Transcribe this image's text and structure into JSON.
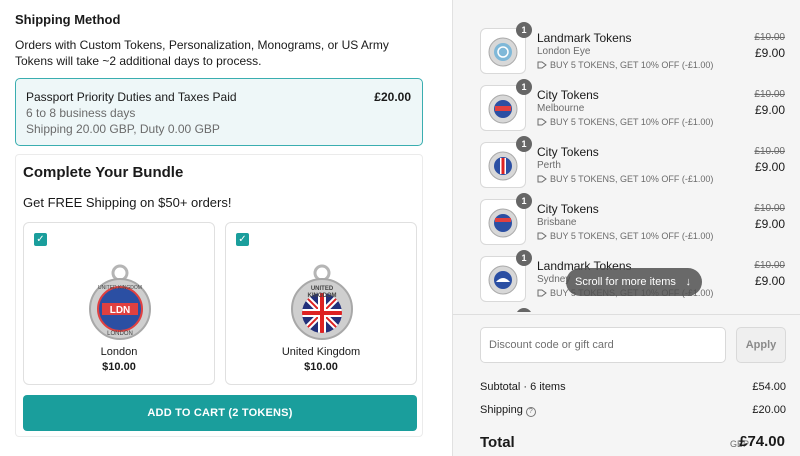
{
  "shipping": {
    "title": "Shipping Method",
    "note": "Orders with Custom Tokens, Personalization, Monograms, or US Army Tokens will take ~2 additional days to process.",
    "method": {
      "name": "Passport Priority Duties and Taxes Paid",
      "price": "£20.00",
      "days": "6 to 8 business days",
      "breakdown": "Shipping 20.00 GBP, Duty 0.00 GBP"
    }
  },
  "bundle": {
    "title": "Complete Your Bundle",
    "subtitle": "Get FREE Shipping on $50+ orders!",
    "items": [
      {
        "name": "London",
        "price": "$10.00",
        "checked": true,
        "token_top": "UNITED KINGDOM",
        "token_bottom": "LONDON",
        "token_mid": "LDN"
      },
      {
        "name": "United Kingdom",
        "price": "$10.00",
        "checked": true,
        "token_top": "UNITED",
        "token_bottom": "KINGDOM",
        "token_mid": ""
      }
    ],
    "add_button": "ADD TO CART (2 TOKENS)"
  },
  "cart": {
    "items": [
      {
        "title": "Landmark Tokens",
        "variant": "London Eye",
        "discount": "BUY 5 TOKENS, GET 10% OFF (-£1.00)",
        "old_price": "£10.00",
        "price": "£9.00",
        "qty": "1"
      },
      {
        "title": "City Tokens",
        "variant": "Melbourne",
        "discount": "BUY 5 TOKENS, GET 10% OFF (-£1.00)",
        "old_price": "£10.00",
        "price": "£9.00",
        "qty": "1"
      },
      {
        "title": "City Tokens",
        "variant": "Perth",
        "discount": "BUY 5 TOKENS, GET 10% OFF (-£1.00)",
        "old_price": "£10.00",
        "price": "£9.00",
        "qty": "1"
      },
      {
        "title": "City Tokens",
        "variant": "Brisbane",
        "discount": "BUY 5 TOKENS, GET 10% OFF (-£1.00)",
        "old_price": "£10.00",
        "price": "£9.00",
        "qty": "1"
      },
      {
        "title": "Landmark Tokens",
        "variant": "Sydney",
        "discount": "BUY 5 TOKENS, GET 10% OFF (-£1.00)",
        "old_price": "£10.00",
        "price": "£9.00",
        "qty": "1"
      }
    ],
    "scroll_hint": "Scroll for more items",
    "discount_placeholder": "Discount code or gift card",
    "apply_label": "Apply",
    "subtotal_label": "Subtotal · 6 items",
    "subtotal_value": "£54.00",
    "shipping_label": "Shipping",
    "shipping_value": "£20.00",
    "total_label": "Total",
    "total_currency": "GBP",
    "total_value": "£74.00"
  },
  "colors": {
    "accent": "#1a9e9c",
    "selected_border": "#3aaeb0",
    "selected_bg": "#eef7f8"
  },
  "icons": {
    "check": "check-icon",
    "tag": "tag-icon",
    "info": "info-icon",
    "arrow": "arrow-down-icon"
  }
}
